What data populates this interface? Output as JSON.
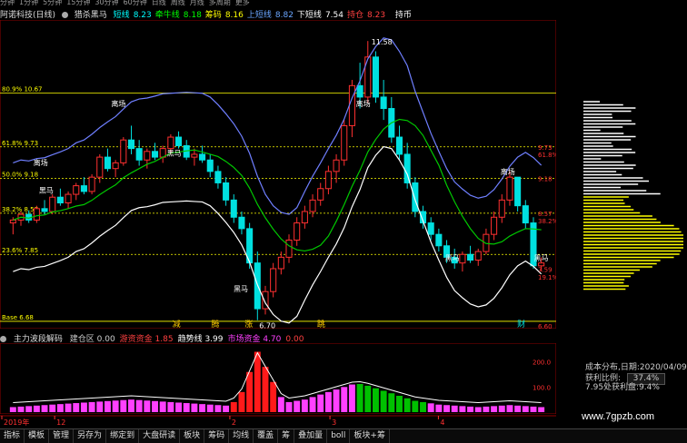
{
  "toolbar": {
    "timeframes": [
      "分钟",
      "1分钟",
      "5分钟",
      "15分钟",
      "30分钟",
      "60分钟",
      "日线",
      "周线",
      "月线",
      "多周期",
      "更多"
    ]
  },
  "info_bar": {
    "stock": "阿诺科技(日线)",
    "indicator": "猎杀黑马",
    "items": [
      {
        "label": "短线",
        "value": "8.23",
        "color": "#00ffff"
      },
      {
        "label": "牵牛线",
        "value": "8.18",
        "color": "#00ff00"
      },
      {
        "label": "筹码",
        "value": "8.16",
        "color": "#ffff00"
      },
      {
        "label": "上短线",
        "value": "8.82",
        "color": "#6aa6ff"
      },
      {
        "label": "下短线",
        "value": "7.54",
        "color": "#ffffff"
      },
      {
        "label": "持仓",
        "value": "8.23",
        "color": "#ff4040"
      }
    ],
    "tail": "持币"
  },
  "fib_levels": [
    {
      "text": "80.9% 10.67",
      "value": 10.67,
      "color": "#ffff00"
    },
    {
      "text": "61.8% 9.73",
      "value": 9.73,
      "color": "#ffff00"
    },
    {
      "text": "50.0% 9.18",
      "value": 9.18,
      "color": "#ffff00"
    },
    {
      "text": "38.2% 8.57",
      "value": 8.57,
      "color": "#ffff00"
    },
    {
      "text": "23.6% 7.85",
      "value": 7.85,
      "color": "#ffff00"
    },
    {
      "text": "Base 6.68",
      "value": 6.68,
      "color": "#ffff00"
    }
  ],
  "price_labels": {
    "high": "11.58",
    "low": "6.70"
  },
  "signal_labels": [
    "减",
    "腾",
    "涨",
    "跳",
    "财"
  ],
  "annotations": {
    "escape": "离场",
    "horse": "黑马"
  },
  "right_axis": [
    {
      "text": "9.73",
      "value": 9.73
    },
    {
      "text": "61.8%",
      "value": 9.6
    },
    {
      "text": "9.18",
      "value": 9.18
    },
    {
      "text": "8.57",
      "value": 8.57
    },
    {
      "text": "38.2%",
      "value": 8.44
    },
    {
      "text": "7.59",
      "value": 7.59
    },
    {
      "text": "19.1%",
      "value": 7.46
    },
    {
      "text": "6.60",
      "value": 6.6
    }
  ],
  "sub_info": {
    "title": "主力波段解码",
    "items": [
      {
        "label": "建仓区",
        "value": "0.00",
        "color": "#cccccc"
      },
      {
        "label": "游资资金",
        "value": "1.85",
        "color": "#ff4040"
      },
      {
        "label": "趋势线",
        "value": "3.99",
        "color": "#ffffff"
      },
      {
        "label": "市场资金",
        "value": "4.70",
        "color": "#ff40ff"
      },
      {
        "label": "",
        "value": "0.00",
        "color": "#ff4040"
      }
    ]
  },
  "sub_axis": [
    {
      "text": "200.0",
      "value": 200
    },
    {
      "text": "100.0",
      "value": 100
    }
  ],
  "x_axis_labels": [
    {
      "text": "2019年",
      "pos": 0.0
    },
    {
      "text": "12",
      "pos": 0.095
    },
    {
      "text": "2",
      "pos": 0.41
    },
    {
      "text": "3",
      "pos": 0.59
    },
    {
      "text": "4",
      "pos": 0.785
    }
  ],
  "cost_info": {
    "date_label": "成本分布,日期:",
    "date": "2020/04/09",
    "profit_label": "获利比例:",
    "profit_value": "37.4%",
    "cost_label": "7.95处获利盘:",
    "cost_value": "9.4%"
  },
  "watermark": "www.7gpzb.com",
  "bottom_tabs": [
    "指标",
    "模板",
    "管理",
    "另存为",
    "绑定到",
    "大盘研读",
    "板块",
    "筹码",
    "均线",
    "覆盖",
    "筹",
    "叠加量",
    "boll",
    "板块+筹"
  ],
  "chart_data": {
    "type": "candlestick",
    "title": "",
    "ylim": [
      6.6,
      11.9
    ],
    "candles": [
      [
        8.4,
        8.5,
        8.2,
        8.45
      ],
      [
        8.45,
        8.6,
        8.35,
        8.55
      ],
      [
        8.55,
        8.62,
        8.4,
        8.45
      ],
      [
        8.45,
        8.7,
        8.4,
        8.65
      ],
      [
        8.65,
        8.8,
        8.55,
        8.6
      ],
      [
        8.6,
        8.9,
        8.55,
        8.85
      ],
      [
        8.85,
        9.0,
        8.7,
        8.75
      ],
      [
        8.75,
        8.95,
        8.65,
        8.9
      ],
      [
        8.9,
        9.1,
        8.8,
        9.05
      ],
      [
        9.05,
        9.2,
        8.9,
        8.95
      ],
      [
        8.95,
        9.25,
        8.9,
        9.2
      ],
      [
        9.2,
        9.6,
        9.1,
        9.55
      ],
      [
        9.55,
        9.7,
        9.3,
        9.35
      ],
      [
        9.35,
        9.5,
        9.2,
        9.45
      ],
      [
        9.45,
        9.9,
        9.4,
        9.85
      ],
      [
        9.85,
        10.1,
        9.6,
        9.7
      ],
      [
        9.7,
        9.85,
        9.4,
        9.5
      ],
      [
        9.5,
        9.7,
        9.35,
        9.65
      ],
      [
        9.65,
        9.8,
        9.5,
        9.55
      ],
      [
        9.55,
        9.75,
        9.45,
        9.7
      ],
      [
        9.7,
        9.95,
        9.6,
        9.9
      ],
      [
        9.9,
        10.0,
        9.7,
        9.75
      ],
      [
        9.75,
        9.85,
        9.5,
        9.55
      ],
      [
        9.55,
        9.7,
        9.4,
        9.6
      ],
      [
        9.6,
        9.75,
        9.45,
        9.5
      ],
      [
        9.5,
        9.6,
        9.2,
        9.3
      ],
      [
        9.3,
        9.4,
        9.0,
        9.1
      ],
      [
        9.1,
        9.2,
        8.7,
        8.8
      ],
      [
        8.8,
        8.9,
        8.4,
        8.5
      ],
      [
        8.5,
        8.6,
        8.2,
        8.3
      ],
      [
        8.3,
        8.4,
        7.6,
        7.7
      ],
      [
        7.7,
        7.9,
        6.7,
        6.9
      ],
      [
        6.9,
        7.3,
        6.8,
        7.2
      ],
      [
        7.2,
        7.7,
        7.1,
        7.6
      ],
      [
        7.6,
        7.9,
        7.5,
        7.8
      ],
      [
        7.8,
        8.2,
        7.7,
        8.1
      ],
      [
        8.1,
        8.5,
        8.0,
        8.4
      ],
      [
        8.4,
        8.7,
        8.3,
        8.6
      ],
      [
        8.6,
        8.9,
        8.5,
        8.8
      ],
      [
        8.8,
        9.1,
        8.7,
        9.0
      ],
      [
        9.0,
        9.4,
        8.9,
        9.3
      ],
      [
        9.3,
        9.6,
        9.1,
        9.5
      ],
      [
        9.5,
        10.2,
        9.4,
        10.1
      ],
      [
        10.1,
        10.9,
        9.9,
        10.8
      ],
      [
        10.8,
        11.2,
        10.4,
        10.6
      ],
      [
        10.6,
        11.58,
        10.5,
        11.3
      ],
      [
        11.3,
        11.4,
        10.5,
        10.6
      ],
      [
        10.6,
        10.9,
        10.2,
        10.4
      ],
      [
        10.4,
        10.6,
        9.8,
        9.9
      ],
      [
        9.9,
        10.1,
        9.5,
        9.6
      ],
      [
        9.6,
        9.8,
        9.0,
        9.1
      ],
      [
        9.1,
        9.2,
        8.5,
        8.6
      ],
      [
        8.6,
        8.7,
        8.3,
        8.4
      ],
      [
        8.4,
        8.5,
        8.1,
        8.2
      ],
      [
        8.2,
        8.3,
        7.9,
        8.0
      ],
      [
        8.0,
        8.1,
        7.7,
        7.8
      ],
      [
        7.8,
        7.95,
        7.6,
        7.7
      ],
      [
        7.7,
        7.9,
        7.55,
        7.85
      ],
      [
        7.85,
        8.0,
        7.7,
        7.75
      ],
      [
        7.75,
        7.95,
        7.65,
        7.9
      ],
      [
        7.9,
        8.3,
        7.85,
        8.2
      ],
      [
        8.2,
        8.6,
        8.1,
        8.5
      ],
      [
        8.5,
        8.9,
        8.4,
        8.8
      ],
      [
        8.8,
        9.3,
        8.7,
        9.2
      ],
      [
        9.2,
        9.1,
        8.6,
        8.7
      ],
      [
        8.7,
        8.8,
        8.3,
        8.4
      ],
      [
        8.4,
        8.5,
        7.6,
        7.65
      ],
      [
        7.65,
        7.8,
        7.55,
        7.7
      ]
    ],
    "sub_bars": [
      20,
      22,
      24,
      26,
      28,
      30,
      32,
      34,
      36,
      38,
      40,
      42,
      44,
      46,
      48,
      50,
      48,
      46,
      44,
      42,
      40,
      38,
      36,
      34,
      32,
      30,
      28,
      26,
      40,
      80,
      160,
      240,
      180,
      120,
      60,
      40,
      45,
      50,
      60,
      70,
      80,
      90,
      100,
      110,
      112,
      105,
      95,
      85,
      75,
      65,
      55,
      45,
      40,
      35,
      30,
      28,
      26,
      24,
      22,
      20,
      22,
      24,
      26,
      28,
      26,
      24,
      22,
      20
    ]
  }
}
